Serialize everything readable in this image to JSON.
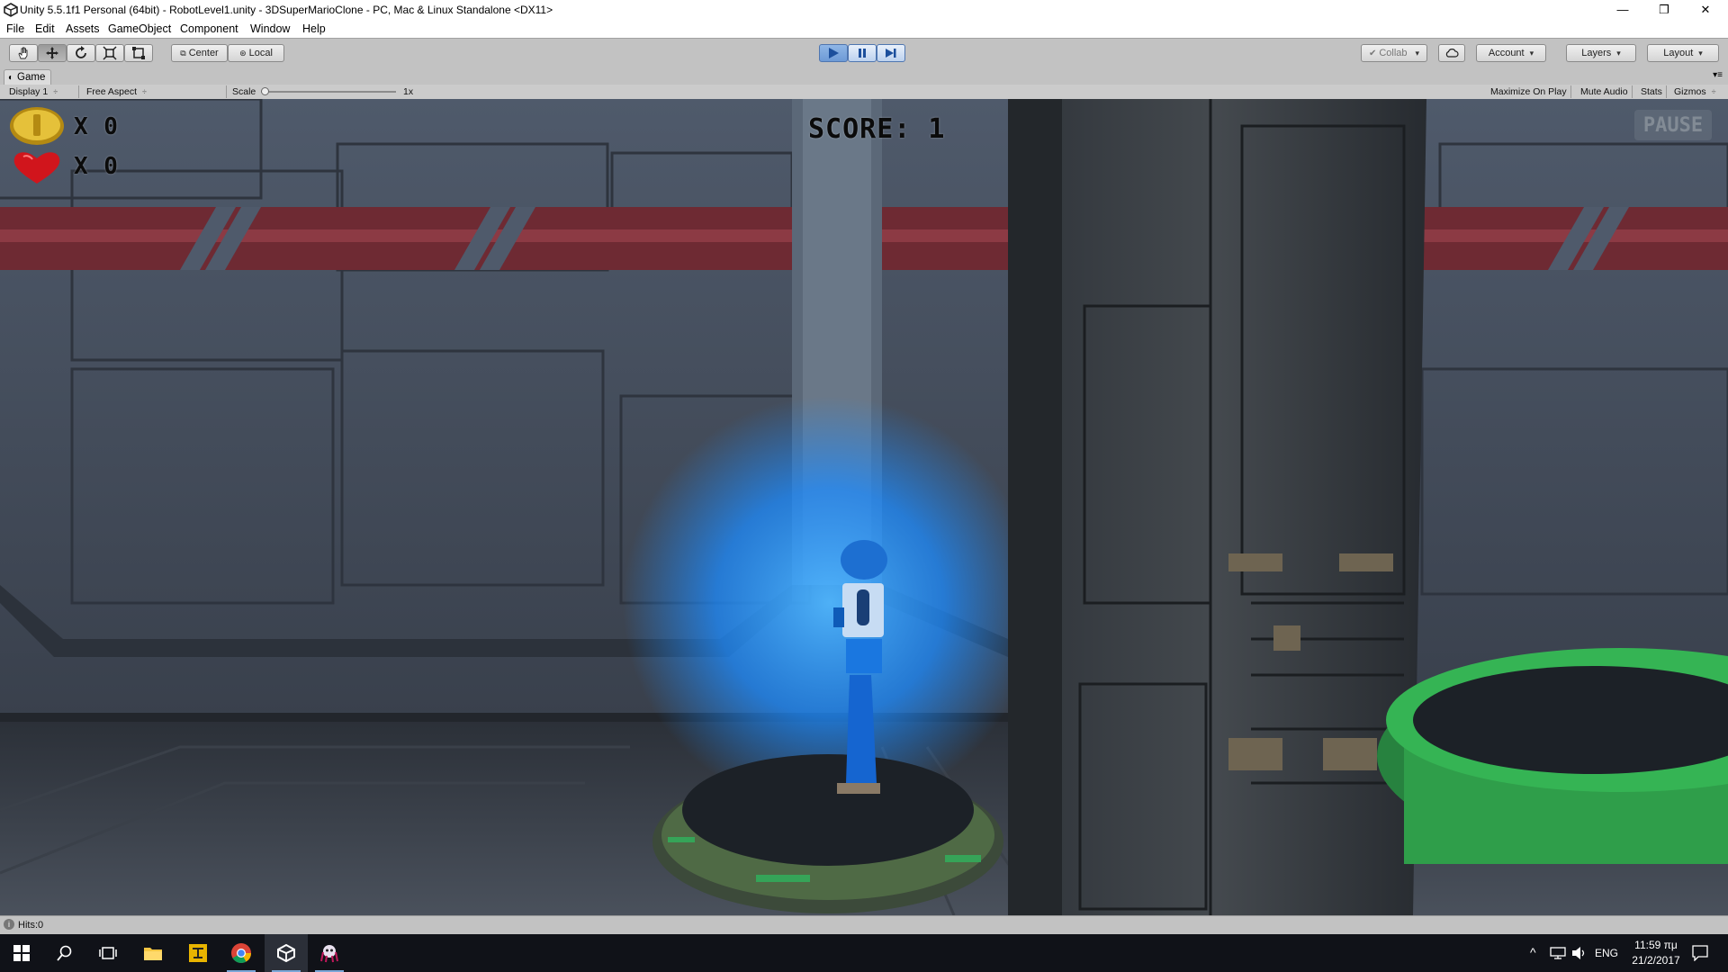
{
  "window": {
    "title": "Unity 5.5.1f1 Personal (64bit) - RobotLevel1.unity - 3DSuperMarioClone - PC, Mac & Linux Standalone <DX11>",
    "minimize": "—",
    "maximize": "❐",
    "close": "✕"
  },
  "menu": [
    "File",
    "Edit",
    "Assets",
    "GameObject",
    "Component",
    "Window",
    "Help"
  ],
  "toolbar": {
    "pivot_label": "Center",
    "space_label": "Local",
    "collab_label": "Collab",
    "account_label": "Account",
    "layers_label": "Layers",
    "layout_label": "Layout",
    "play_active": true
  },
  "game_panel": {
    "tab_label": "Game",
    "display": "Display 1",
    "aspect": "Free Aspect",
    "scale_label": "Scale",
    "scale_value": "1x",
    "maximize_on_play": "Maximize On Play",
    "mute_audio": "Mute Audio",
    "stats": "Stats",
    "gizmos": "Gizmos"
  },
  "hud": {
    "coins": "X 0",
    "lives": "X 0",
    "score": "SCORE: 1",
    "pause": "PAUSE"
  },
  "status": {
    "message": "Hits:0"
  },
  "taskbar": {
    "language": "ENG",
    "time": "11:59 πμ",
    "date": "21/2/2017"
  },
  "colors": {
    "accent_play": "#6d9ad6",
    "glow": "#1e8cff",
    "platform_green": "#2f9e4a"
  }
}
